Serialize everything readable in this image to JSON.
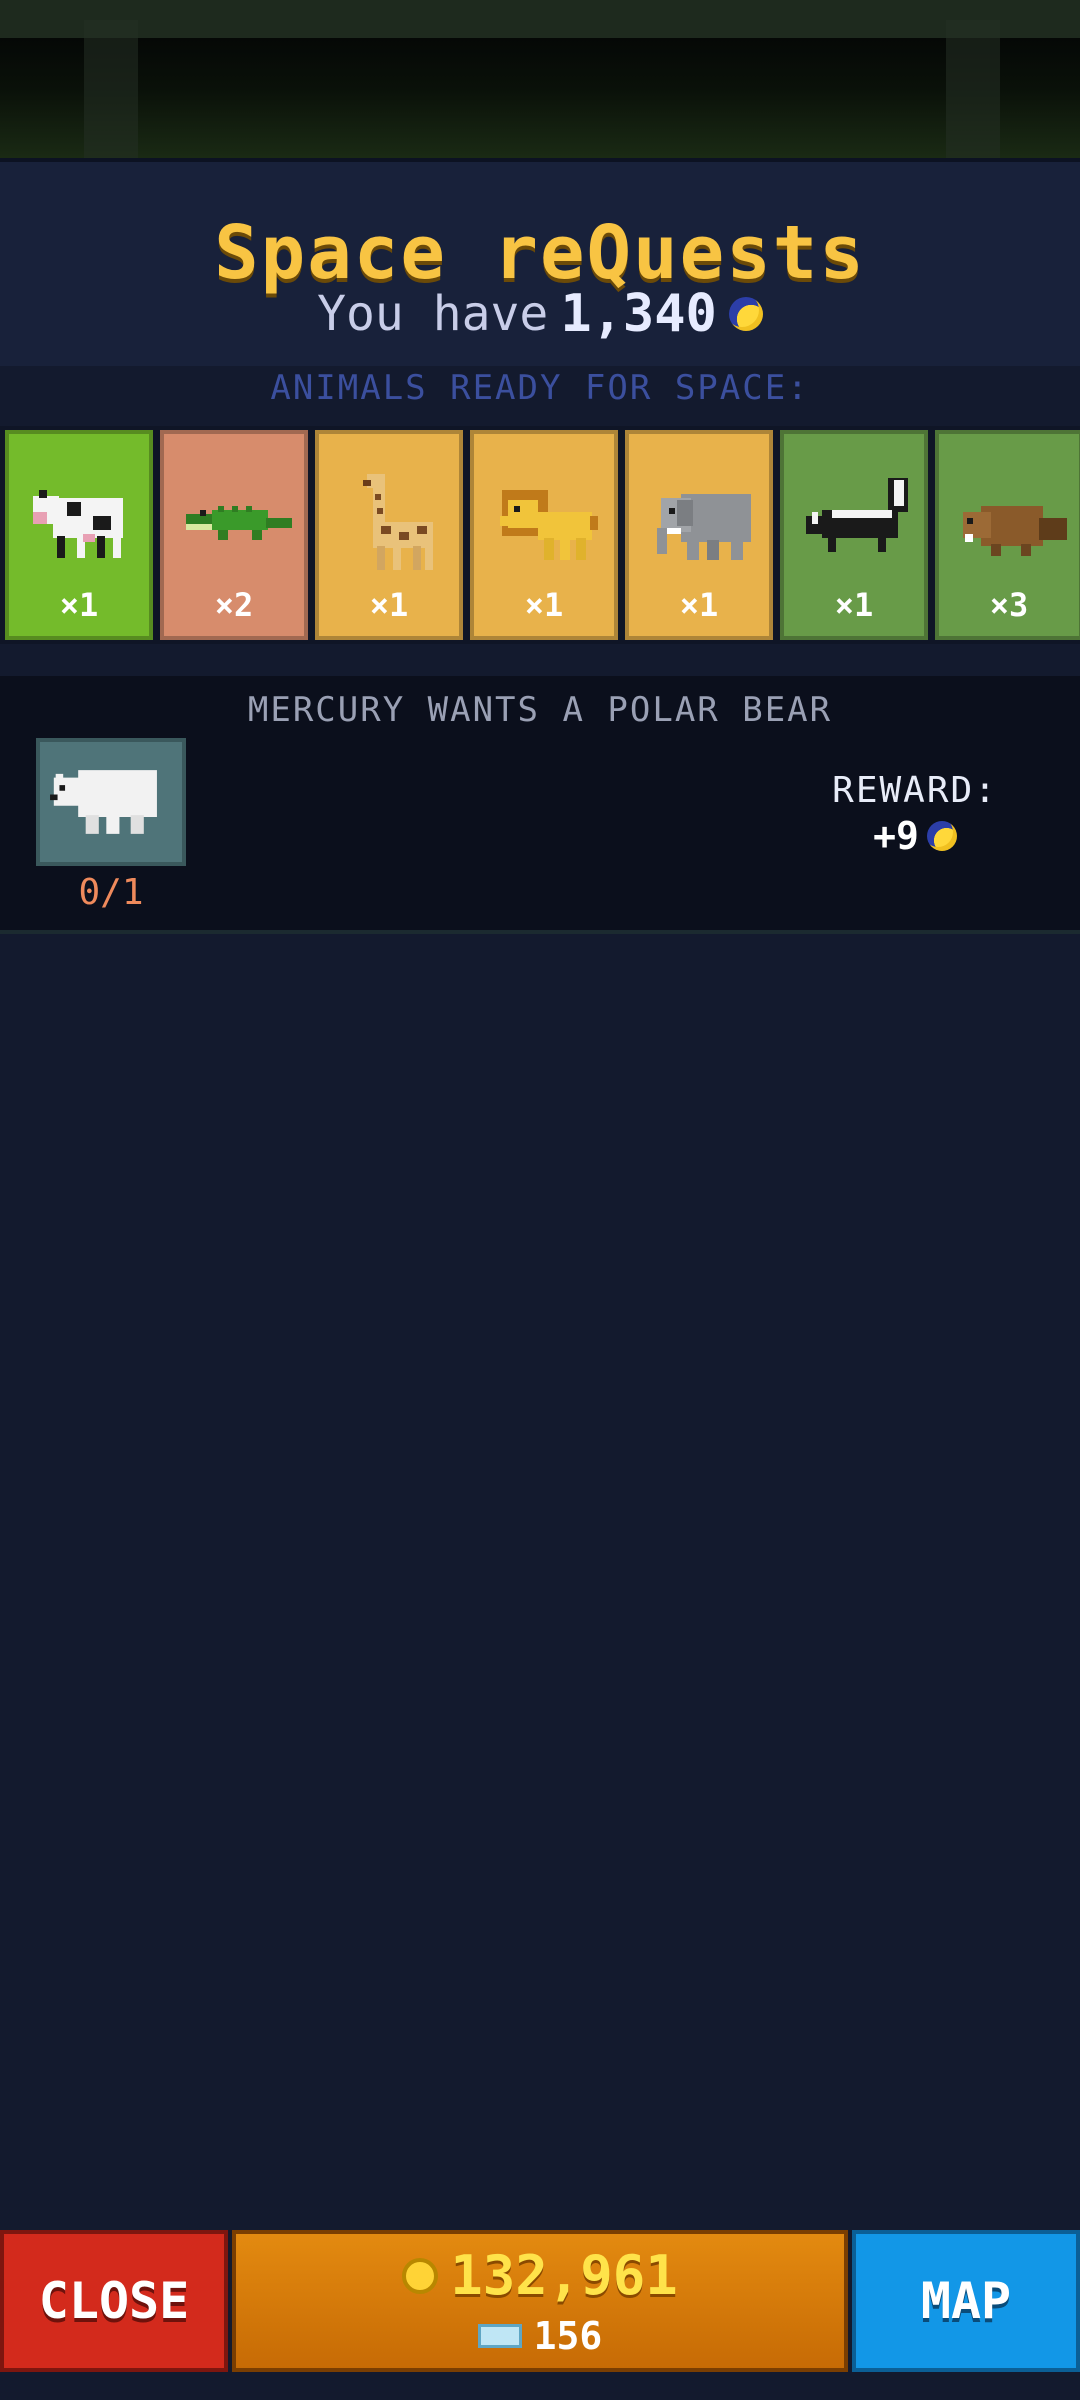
{
  "header": {
    "title": "Space reQuests",
    "have_label": "You have",
    "have_value": "1,340",
    "currency_icon": "moon-icon"
  },
  "animals": {
    "section_label": "ANIMALS READY FOR SPACE:",
    "items": [
      {
        "icon": "cow-icon",
        "count": "×1",
        "color": "#74bb2b"
      },
      {
        "icon": "crocodile-icon",
        "count": "×2",
        "color": "#d78c6c"
      },
      {
        "icon": "giraffe-icon",
        "count": "×1",
        "color": "#e8b24b"
      },
      {
        "icon": "lion-icon",
        "count": "×1",
        "color": "#e8b24b"
      },
      {
        "icon": "elephant-icon",
        "count": "×1",
        "color": "#e8b24b"
      },
      {
        "icon": "skunk-icon",
        "count": "×1",
        "color": "#689b48"
      },
      {
        "icon": "beaver-icon",
        "count": "×3",
        "color": "#689b48"
      }
    ]
  },
  "request": {
    "title": "MERCURY WANTS A POLAR BEAR",
    "animal_icon": "polar-bear-icon",
    "progress": "0/1",
    "reward_label": "REWARD:",
    "reward_value": "+9"
  },
  "bottom": {
    "close_label": "CLOSE",
    "coins": "132,961",
    "gems": "156",
    "map_label": "MAP"
  }
}
